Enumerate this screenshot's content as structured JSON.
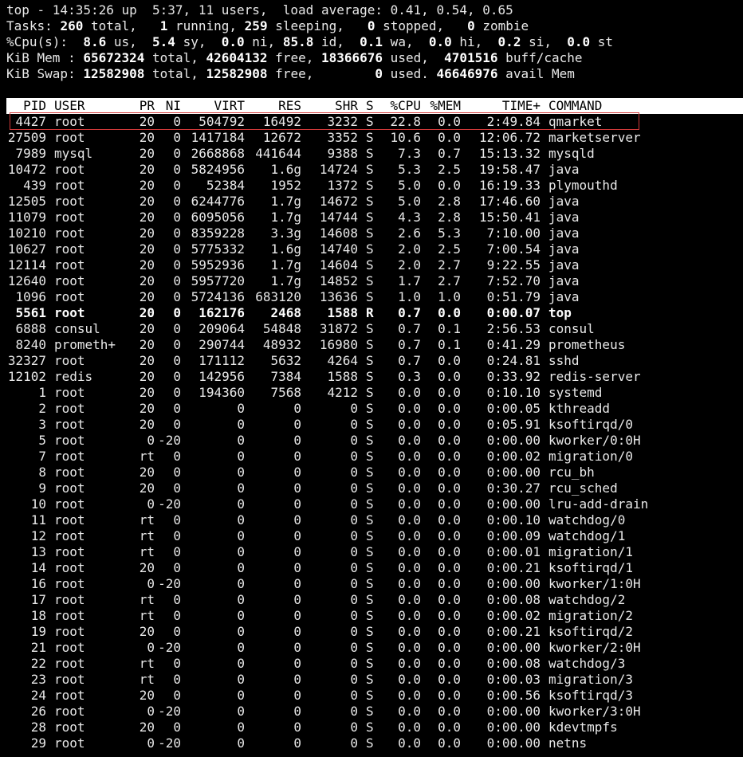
{
  "summary": {
    "line1": "top - 14:35:26 up  5:37, 11 users,  load average: 0.41, 0.54, 0.65",
    "tasks": {
      "label": "Tasks:",
      "total": "260",
      "total_lbl": " total,",
      "running": "1",
      "running_lbl": " running,",
      "sleeping": "259",
      "sleeping_lbl": " sleeping,",
      "stopped": "0",
      "stopped_lbl": " stopped,",
      "zombie": "0",
      "zombie_lbl": " zombie"
    },
    "cpu": {
      "label": "%Cpu(s):",
      "us": "8.6",
      "us_lbl": " us,",
      "sy": "5.4",
      "sy_lbl": " sy,",
      "ni": "0.0",
      "ni_lbl": " ni,",
      "id": "85.8",
      "id_lbl": " id,",
      "wa": "0.1",
      "wa_lbl": " wa,",
      "hi": "0.0",
      "hi_lbl": " hi,",
      "si": "0.2",
      "si_lbl": " si,",
      "st": "0.0",
      "st_lbl": " st"
    },
    "mem": {
      "label": "KiB Mem :",
      "total": "65672324",
      "total_lbl": " total,",
      "free": "42604132",
      "free_lbl": " free,",
      "used": "18366676",
      "used_lbl": " used,",
      "buff": "4701516",
      "buff_lbl": " buff/cache"
    },
    "swap": {
      "label": "KiB Swap:",
      "total": "12582908",
      "total_lbl": " total,",
      "free": "12582908",
      "free_lbl": " free,",
      "used": "0",
      "used_lbl": " used.",
      "avail": "46646976",
      "avail_lbl": " avail Mem"
    }
  },
  "columns": [
    "PID",
    "USER",
    "PR",
    "NI",
    "VIRT",
    "RES",
    "SHR",
    "S",
    "%CPU",
    "%MEM",
    "TIME+",
    "COMMAND"
  ],
  "processes": [
    [
      "4427",
      "root",
      "20",
      "0",
      "504792",
      "16492",
      "3232",
      "S",
      "22.8",
      "0.0",
      "2:49.84",
      "qmarket"
    ],
    [
      "27509",
      "root",
      "20",
      "0",
      "1417184",
      "12672",
      "3352",
      "S",
      "10.6",
      "0.0",
      "12:06.72",
      "marketserver"
    ],
    [
      "7989",
      "mysql",
      "20",
      "0",
      "2668868",
      "441644",
      "9388",
      "S",
      "7.3",
      "0.7",
      "15:13.32",
      "mysqld"
    ],
    [
      "10472",
      "root",
      "20",
      "0",
      "5824956",
      "1.6g",
      "14724",
      "S",
      "5.3",
      "2.5",
      "19:58.47",
      "java"
    ],
    [
      "439",
      "root",
      "20",
      "0",
      "52384",
      "1952",
      "1372",
      "S",
      "5.0",
      "0.0",
      "16:19.33",
      "plymouthd"
    ],
    [
      "12505",
      "root",
      "20",
      "0",
      "6244776",
      "1.7g",
      "14672",
      "S",
      "5.0",
      "2.8",
      "17:46.60",
      "java"
    ],
    [
      "11079",
      "root",
      "20",
      "0",
      "6095056",
      "1.7g",
      "14744",
      "S",
      "4.3",
      "2.8",
      "15:50.41",
      "java"
    ],
    [
      "10210",
      "root",
      "20",
      "0",
      "8359228",
      "3.3g",
      "14608",
      "S",
      "2.6",
      "5.3",
      "7:10.00",
      "java"
    ],
    [
      "10627",
      "root",
      "20",
      "0",
      "5775332",
      "1.6g",
      "14740",
      "S",
      "2.0",
      "2.5",
      "7:00.54",
      "java"
    ],
    [
      "12114",
      "root",
      "20",
      "0",
      "5952936",
      "1.7g",
      "14604",
      "S",
      "2.0",
      "2.7",
      "9:22.55",
      "java"
    ],
    [
      "12640",
      "root",
      "20",
      "0",
      "5957720",
      "1.7g",
      "14852",
      "S",
      "1.7",
      "2.7",
      "7:52.70",
      "java"
    ],
    [
      "1096",
      "root",
      "20",
      "0",
      "5724136",
      "683120",
      "13636",
      "S",
      "1.0",
      "1.0",
      "0:51.79",
      "java"
    ],
    [
      "5561",
      "root",
      "20",
      "0",
      "162176",
      "2468",
      "1588",
      "R",
      "0.7",
      "0.0",
      "0:00.07",
      "top"
    ],
    [
      "6888",
      "consul",
      "20",
      "0",
      "209064",
      "54848",
      "31872",
      "S",
      "0.7",
      "0.1",
      "2:56.53",
      "consul"
    ],
    [
      "8240",
      "prometh+",
      "20",
      "0",
      "290744",
      "48932",
      "16980",
      "S",
      "0.7",
      "0.1",
      "0:41.29",
      "prometheus"
    ],
    [
      "32327",
      "root",
      "20",
      "0",
      "171112",
      "5632",
      "4264",
      "S",
      "0.7",
      "0.0",
      "0:24.81",
      "sshd"
    ],
    [
      "12102",
      "redis",
      "20",
      "0",
      "142956",
      "7384",
      "1588",
      "S",
      "0.3",
      "0.0",
      "0:33.92",
      "redis-server"
    ],
    [
      "1",
      "root",
      "20",
      "0",
      "194360",
      "7568",
      "4212",
      "S",
      "0.0",
      "0.0",
      "0:10.10",
      "systemd"
    ],
    [
      "2",
      "root",
      "20",
      "0",
      "0",
      "0",
      "0",
      "S",
      "0.0",
      "0.0",
      "0:00.05",
      "kthreadd"
    ],
    [
      "3",
      "root",
      "20",
      "0",
      "0",
      "0",
      "0",
      "S",
      "0.0",
      "0.0",
      "0:05.91",
      "ksoftirqd/0"
    ],
    [
      "5",
      "root",
      "0",
      "-20",
      "0",
      "0",
      "0",
      "S",
      "0.0",
      "0.0",
      "0:00.00",
      "kworker/0:0H"
    ],
    [
      "7",
      "root",
      "rt",
      "0",
      "0",
      "0",
      "0",
      "S",
      "0.0",
      "0.0",
      "0:00.02",
      "migration/0"
    ],
    [
      "8",
      "root",
      "20",
      "0",
      "0",
      "0",
      "0",
      "S",
      "0.0",
      "0.0",
      "0:00.00",
      "rcu_bh"
    ],
    [
      "9",
      "root",
      "20",
      "0",
      "0",
      "0",
      "0",
      "S",
      "0.0",
      "0.0",
      "0:30.27",
      "rcu_sched"
    ],
    [
      "10",
      "root",
      "0",
      "-20",
      "0",
      "0",
      "0",
      "S",
      "0.0",
      "0.0",
      "0:00.00",
      "lru-add-drain"
    ],
    [
      "11",
      "root",
      "rt",
      "0",
      "0",
      "0",
      "0",
      "S",
      "0.0",
      "0.0",
      "0:00.10",
      "watchdog/0"
    ],
    [
      "12",
      "root",
      "rt",
      "0",
      "0",
      "0",
      "0",
      "S",
      "0.0",
      "0.0",
      "0:00.09",
      "watchdog/1"
    ],
    [
      "13",
      "root",
      "rt",
      "0",
      "0",
      "0",
      "0",
      "S",
      "0.0",
      "0.0",
      "0:00.01",
      "migration/1"
    ],
    [
      "14",
      "root",
      "20",
      "0",
      "0",
      "0",
      "0",
      "S",
      "0.0",
      "0.0",
      "0:00.21",
      "ksoftirqd/1"
    ],
    [
      "16",
      "root",
      "0",
      "-20",
      "0",
      "0",
      "0",
      "S",
      "0.0",
      "0.0",
      "0:00.00",
      "kworker/1:0H"
    ],
    [
      "17",
      "root",
      "rt",
      "0",
      "0",
      "0",
      "0",
      "S",
      "0.0",
      "0.0",
      "0:00.08",
      "watchdog/2"
    ],
    [
      "18",
      "root",
      "rt",
      "0",
      "0",
      "0",
      "0",
      "S",
      "0.0",
      "0.0",
      "0:00.02",
      "migration/2"
    ],
    [
      "19",
      "root",
      "20",
      "0",
      "0",
      "0",
      "0",
      "S",
      "0.0",
      "0.0",
      "0:00.21",
      "ksoftirqd/2"
    ],
    [
      "21",
      "root",
      "0",
      "-20",
      "0",
      "0",
      "0",
      "S",
      "0.0",
      "0.0",
      "0:00.00",
      "kworker/2:0H"
    ],
    [
      "22",
      "root",
      "rt",
      "0",
      "0",
      "0",
      "0",
      "S",
      "0.0",
      "0.0",
      "0:00.08",
      "watchdog/3"
    ],
    [
      "23",
      "root",
      "rt",
      "0",
      "0",
      "0",
      "0",
      "S",
      "0.0",
      "0.0",
      "0:00.03",
      "migration/3"
    ],
    [
      "24",
      "root",
      "20",
      "0",
      "0",
      "0",
      "0",
      "S",
      "0.0",
      "0.0",
      "0:00.56",
      "ksoftirqd/3"
    ],
    [
      "26",
      "root",
      "0",
      "-20",
      "0",
      "0",
      "0",
      "S",
      "0.0",
      "0.0",
      "0:00.00",
      "kworker/3:0H"
    ],
    [
      "28",
      "root",
      "20",
      "0",
      "0",
      "0",
      "0",
      "S",
      "0.0",
      "0.0",
      "0:00.00",
      "kdevtmpfs"
    ],
    [
      "29",
      "root",
      "0",
      "-20",
      "0",
      "0",
      "0",
      "S",
      "0.0",
      "0.0",
      "0:00.00",
      "netns"
    ]
  ],
  "bold_pid": "5561",
  "highlight_pid": "4427",
  "colors": {
    "background": "#000000",
    "text": "#e8e8e8",
    "header_bg": "#ffffff",
    "header_text": "#000000",
    "highlight_border": "#d23a3a"
  }
}
